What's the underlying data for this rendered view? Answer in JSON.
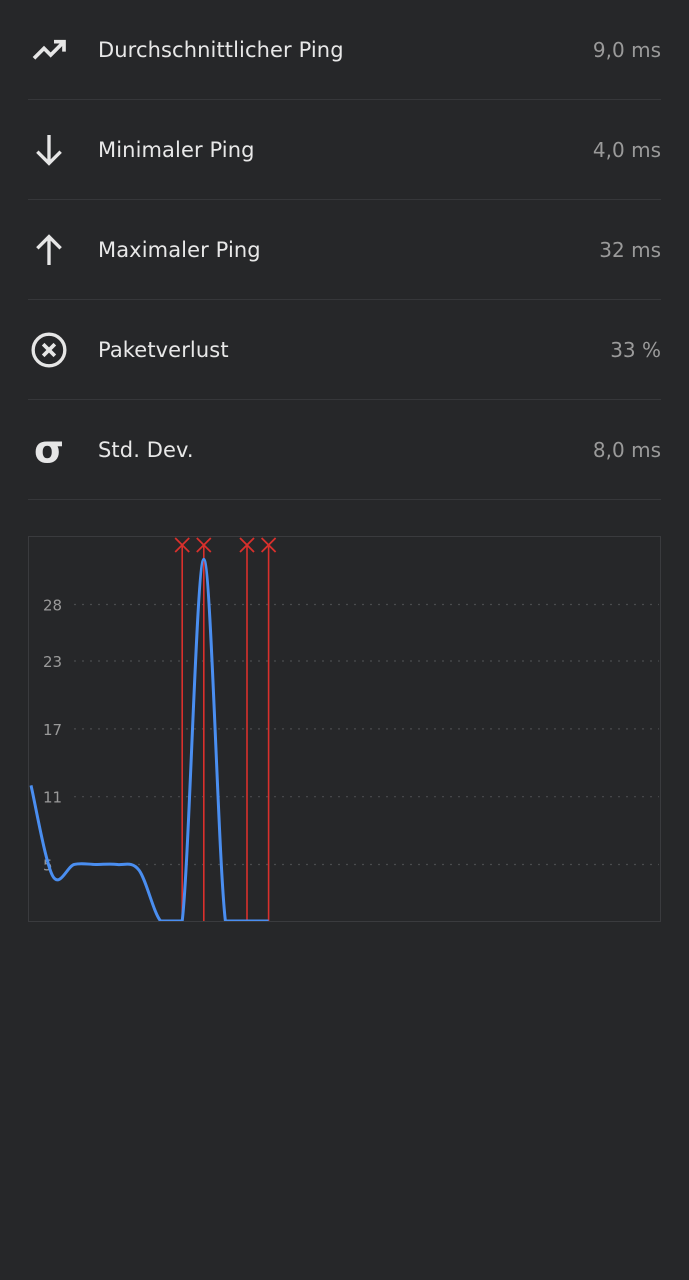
{
  "stats": [
    {
      "icon": "trending-up-icon",
      "label": "Durchschnittlicher Ping",
      "value": "9,0 ms"
    },
    {
      "icon": "arrow-down-icon",
      "label": "Minimaler Ping",
      "value": "4,0 ms"
    },
    {
      "icon": "arrow-up-icon",
      "label": "Maximaler Ping",
      "value": "32 ms"
    },
    {
      "icon": "circle-x-icon",
      "label": "Paketverlust",
      "value": "33 %"
    },
    {
      "icon": "sigma-icon",
      "label": "Std. Dev.",
      "value": "8,0 ms"
    }
  ],
  "colors": {
    "background": "#262729",
    "line": "#4a8ef0",
    "loss_marker": "#d9302c",
    "grid": "#4a4b4e",
    "tick": "#9a9a9a"
  },
  "chart_data": {
    "type": "line",
    "yticks": [
      "28",
      "23",
      "17",
      "11",
      "5"
    ],
    "ylim": [
      0,
      33
    ],
    "x": [
      0,
      1,
      2,
      3,
      4,
      5,
      6,
      7,
      8,
      9,
      10,
      11
    ],
    "values": [
      12,
      4,
      5,
      5,
      5,
      4.5,
      0,
      0,
      32,
      0,
      0,
      0
    ],
    "lost_packets": [
      7,
      8,
      10,
      11
    ],
    "grid": true
  }
}
